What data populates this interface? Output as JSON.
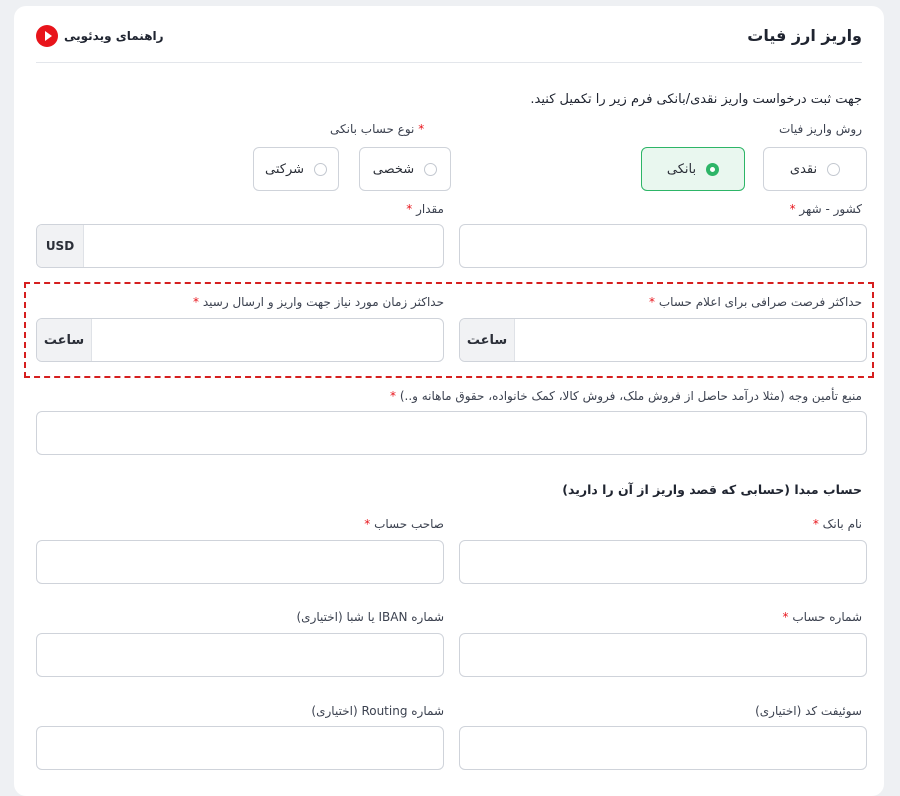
{
  "header": {
    "title": "واریز ارز فیات",
    "video_guide": "راهنمای ویدئویی"
  },
  "intro": "جهت ثبت درخواست واریز نقدی/بانکی فرم زیر را تکمیل کنید.",
  "deposit_method": {
    "label": "روش واریز فیات",
    "options": [
      "نقدی",
      "بانکی"
    ],
    "selected": "بانکی"
  },
  "account_type": {
    "label": "نوع حساب بانکی",
    "required": "*",
    "options": [
      "شخصی",
      "شرکتی"
    ]
  },
  "country_city": {
    "label": "کشور - شهر",
    "required": "*"
  },
  "amount": {
    "label": "مقدار",
    "required": "*",
    "unit": "USD"
  },
  "max_exchange_time": {
    "label": "حداکثر فرصت صرافی برای اعلام حساب",
    "required": "*",
    "unit": "ساعت"
  },
  "max_deposit_time": {
    "label": "حداکثر زمان مورد نیاز جهت واریز و ارسال رسید",
    "required": "*",
    "unit": "ساعت"
  },
  "source_of_funds": {
    "label": "منبع تأمین وجه (مثلا درآمد حاصل از فروش ملک، فروش کالا، کمک خانواده، حقوق ماهانه و..)",
    "required": "*"
  },
  "origin_account": {
    "heading": "حساب مبدا (حسابی که قصد واریز از آن را دارید)",
    "bank_name": {
      "label": "نام بانک",
      "required": "*"
    },
    "account_holder": {
      "label": "صاحب حساب",
      "required": "*"
    },
    "account_number": {
      "label": "شماره حساب",
      "required": "*"
    },
    "iban": {
      "label": "شماره IBAN یا شبا (اختیاری)"
    },
    "swift": {
      "label": "سوئیفت کد (اختیاری)"
    },
    "routing": {
      "label": "شماره Routing (اختیاری)"
    }
  },
  "colors": {
    "accent": "#2db567",
    "required": "#e8141b",
    "highlight_border": "#d61f1f"
  }
}
